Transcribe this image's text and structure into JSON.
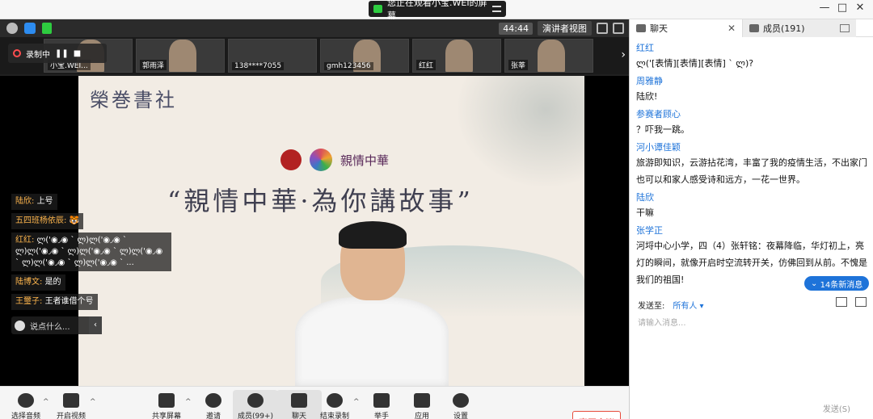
{
  "titlebar": {
    "banner": "您正在观看小宝.WEI的屏幕",
    "min": "—",
    "max": "□",
    "close": "✕"
  },
  "topbar": {
    "timer": "44:44",
    "view_label": "演讲者视图"
  },
  "recording": {
    "label": "录制中"
  },
  "thumbnails": [
    {
      "label": "小宝.WEI..."
    },
    {
      "label": "郭雨泽"
    },
    {
      "label": "138****7055"
    },
    {
      "label": "gmh123456"
    },
    {
      "label": "红红"
    },
    {
      "label": "张莘"
    }
  ],
  "video": {
    "calligraphy": "榮巻書社",
    "logo_text": "親情中華",
    "slogan": "“親情中華·為你講故事”"
  },
  "overlay_chat": [
    {
      "name": "陆欣:",
      "text": "上号"
    },
    {
      "name": "五四班杨依辰:",
      "text": "🐯"
    },
    {
      "name": "红红:",
      "text": "ლ('◉◞◉ ` ლ)ლ('◉◞◉ ` ლ)ლ('◉◞◉ ` ლ)ლ('◉◞◉ ` ლ)ლ('◉◞◉ ` ლ)ლ('◉◞◉ ` ლ)ლ('◉◞◉ ` ..."
    },
    {
      "name": "陆博文:",
      "text": "是的"
    },
    {
      "name": "王璽子:",
      "text": "王者谁借个号"
    }
  ],
  "overlay_input": {
    "placeholder": "说点什么..."
  },
  "toolbar": {
    "audio": "选择音频",
    "video": "开启视频",
    "share": "共享屏幕",
    "invite": "邀请",
    "members": "成员(99+)",
    "chat": "聊天",
    "end_record": "结束录制",
    "raise_hand": "举手",
    "apps": "应用",
    "settings": "设置",
    "leave": "离开会议"
  },
  "panel": {
    "chat_tab": "聊天",
    "members_tab": "成员(191)",
    "messages": [
      {
        "name": "红红",
        "text": "ლ('[表情][表情][表情] ` ლ)?"
      },
      {
        "name": "周雅静",
        "text": "陆欣!"
      },
      {
        "name": "参赛者顾心",
        "text": "？吓我一跳。"
      },
      {
        "name": "河小谭佳颖",
        "text": "旅游即知识，云游拈花湾，丰富了我的疫情生活，不出家门也可以和家人感受诗和远方，一花一世界。"
      },
      {
        "name": "陆欣",
        "text": "干嘛"
      },
      {
        "name": "张学正",
        "text": "河埒中心小学，四（4）张轩铭：夜幕降临，华灯初上，亮灯的瞬间，就像开启时空流转开关，仿佛回到从前。不愧是我们的祖国!"
      }
    ],
    "new_messages": "14条新消息",
    "send_to_label": "发送至:",
    "send_to_target": "所有人 ▾",
    "input_placeholder": "请输入消息...",
    "send": "发送(S)"
  }
}
